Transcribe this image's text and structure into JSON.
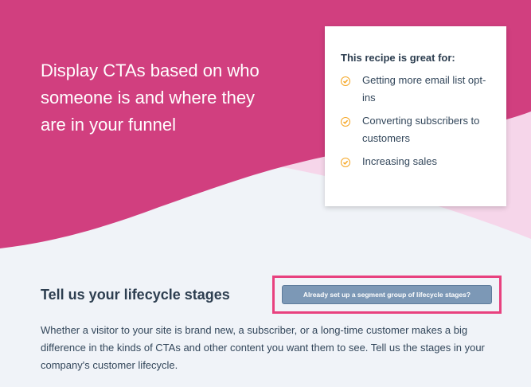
{
  "hero": {
    "title": "Display CTAs based on who\nsomeone is and where they\nare in your funnel"
  },
  "card": {
    "title": "This recipe is great for:",
    "items": [
      "Getting more email list opt-ins",
      "Converting subscribers to customers",
      "Increasing sales"
    ]
  },
  "section": {
    "heading": "Tell us your lifecycle stages",
    "button_label": "Already set up a segment group of lifecycle stages?",
    "description": "Whether a visitor to your site is brand new, a subscriber, or a long-time customer makes a big difference in the kinds of CTAs and other content you want them to see. Tell us the stages in your company's customer lifecycle."
  },
  "colors": {
    "hero_magenta": "#d13f7f",
    "wave_pink": "#f6d6ea",
    "check_orange": "#f5a623",
    "button_bg": "#7c98b6",
    "highlight_border": "#e8417f"
  },
  "icons": {
    "benefit_icon": "check-circle-icon"
  }
}
